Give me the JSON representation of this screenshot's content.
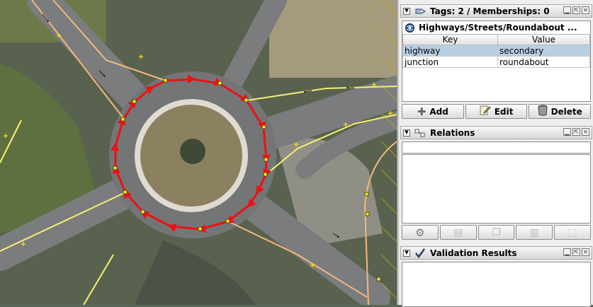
{
  "tags_panel": {
    "title": "Tags: 2 / Memberships: 0",
    "preset_name": "Highways/Streets/Roundabout ...",
    "columns": {
      "key": "Key",
      "value": "Value"
    },
    "rows": [
      {
        "key": "highway",
        "value": "secondary",
        "selected": true
      },
      {
        "key": "junction",
        "value": "roundabout",
        "selected": false
      }
    ],
    "buttons": {
      "add": "Add",
      "edit": "Edit",
      "delete": "Delete"
    }
  },
  "relations_panel": {
    "title": "Relations"
  },
  "validation_panel": {
    "title": "Validation Results"
  },
  "colors": {
    "selected_way": "#ee1111",
    "highway_secondary": "#f8f070",
    "highway_tertiary": "#f4b87a",
    "selection_row": "#b8cfe5",
    "node": "#f5e800"
  },
  "icons": {
    "tags": "tag-icon",
    "preset": "preset-globe-icon",
    "relations": "relation-icon",
    "validation": "check-icon",
    "add": "plus-icon",
    "edit": "pencil-icon",
    "delete": "trash-icon"
  }
}
